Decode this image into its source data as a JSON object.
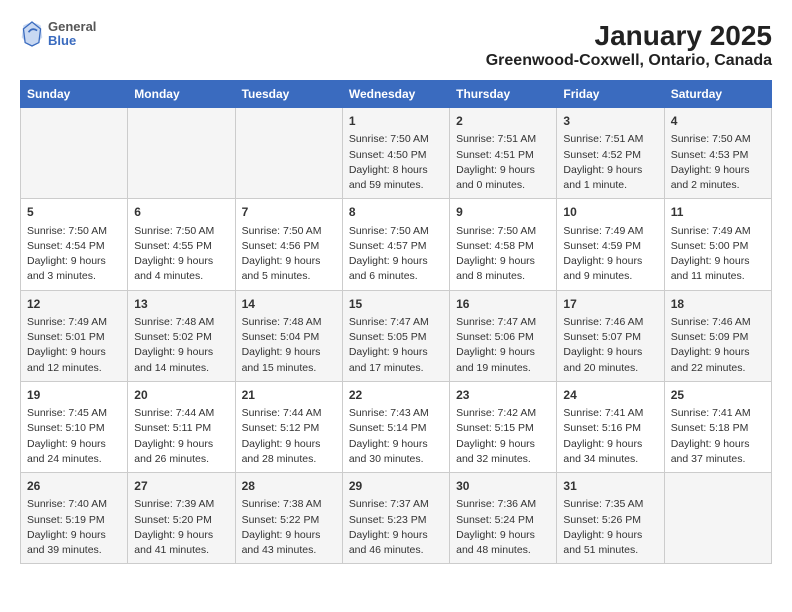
{
  "header": {
    "logo_line1": "General",
    "logo_line2": "Blue",
    "title": "January 2025",
    "subtitle": "Greenwood-Coxwell, Ontario, Canada"
  },
  "days_of_week": [
    "Sunday",
    "Monday",
    "Tuesday",
    "Wednesday",
    "Thursday",
    "Friday",
    "Saturday"
  ],
  "weeks": [
    [
      {
        "day": "",
        "info": ""
      },
      {
        "day": "",
        "info": ""
      },
      {
        "day": "",
        "info": ""
      },
      {
        "day": "1",
        "info": "Sunrise: 7:50 AM\nSunset: 4:50 PM\nDaylight: 8 hours and 59 minutes."
      },
      {
        "day": "2",
        "info": "Sunrise: 7:51 AM\nSunset: 4:51 PM\nDaylight: 9 hours and 0 minutes."
      },
      {
        "day": "3",
        "info": "Sunrise: 7:51 AM\nSunset: 4:52 PM\nDaylight: 9 hours and 1 minute."
      },
      {
        "day": "4",
        "info": "Sunrise: 7:50 AM\nSunset: 4:53 PM\nDaylight: 9 hours and 2 minutes."
      }
    ],
    [
      {
        "day": "5",
        "info": "Sunrise: 7:50 AM\nSunset: 4:54 PM\nDaylight: 9 hours and 3 minutes."
      },
      {
        "day": "6",
        "info": "Sunrise: 7:50 AM\nSunset: 4:55 PM\nDaylight: 9 hours and 4 minutes."
      },
      {
        "day": "7",
        "info": "Sunrise: 7:50 AM\nSunset: 4:56 PM\nDaylight: 9 hours and 5 minutes."
      },
      {
        "day": "8",
        "info": "Sunrise: 7:50 AM\nSunset: 4:57 PM\nDaylight: 9 hours and 6 minutes."
      },
      {
        "day": "9",
        "info": "Sunrise: 7:50 AM\nSunset: 4:58 PM\nDaylight: 9 hours and 8 minutes."
      },
      {
        "day": "10",
        "info": "Sunrise: 7:49 AM\nSunset: 4:59 PM\nDaylight: 9 hours and 9 minutes."
      },
      {
        "day": "11",
        "info": "Sunrise: 7:49 AM\nSunset: 5:00 PM\nDaylight: 9 hours and 11 minutes."
      }
    ],
    [
      {
        "day": "12",
        "info": "Sunrise: 7:49 AM\nSunset: 5:01 PM\nDaylight: 9 hours and 12 minutes."
      },
      {
        "day": "13",
        "info": "Sunrise: 7:48 AM\nSunset: 5:02 PM\nDaylight: 9 hours and 14 minutes."
      },
      {
        "day": "14",
        "info": "Sunrise: 7:48 AM\nSunset: 5:04 PM\nDaylight: 9 hours and 15 minutes."
      },
      {
        "day": "15",
        "info": "Sunrise: 7:47 AM\nSunset: 5:05 PM\nDaylight: 9 hours and 17 minutes."
      },
      {
        "day": "16",
        "info": "Sunrise: 7:47 AM\nSunset: 5:06 PM\nDaylight: 9 hours and 19 minutes."
      },
      {
        "day": "17",
        "info": "Sunrise: 7:46 AM\nSunset: 5:07 PM\nDaylight: 9 hours and 20 minutes."
      },
      {
        "day": "18",
        "info": "Sunrise: 7:46 AM\nSunset: 5:09 PM\nDaylight: 9 hours and 22 minutes."
      }
    ],
    [
      {
        "day": "19",
        "info": "Sunrise: 7:45 AM\nSunset: 5:10 PM\nDaylight: 9 hours and 24 minutes."
      },
      {
        "day": "20",
        "info": "Sunrise: 7:44 AM\nSunset: 5:11 PM\nDaylight: 9 hours and 26 minutes."
      },
      {
        "day": "21",
        "info": "Sunrise: 7:44 AM\nSunset: 5:12 PM\nDaylight: 9 hours and 28 minutes."
      },
      {
        "day": "22",
        "info": "Sunrise: 7:43 AM\nSunset: 5:14 PM\nDaylight: 9 hours and 30 minutes."
      },
      {
        "day": "23",
        "info": "Sunrise: 7:42 AM\nSunset: 5:15 PM\nDaylight: 9 hours and 32 minutes."
      },
      {
        "day": "24",
        "info": "Sunrise: 7:41 AM\nSunset: 5:16 PM\nDaylight: 9 hours and 34 minutes."
      },
      {
        "day": "25",
        "info": "Sunrise: 7:41 AM\nSunset: 5:18 PM\nDaylight: 9 hours and 37 minutes."
      }
    ],
    [
      {
        "day": "26",
        "info": "Sunrise: 7:40 AM\nSunset: 5:19 PM\nDaylight: 9 hours and 39 minutes."
      },
      {
        "day": "27",
        "info": "Sunrise: 7:39 AM\nSunset: 5:20 PM\nDaylight: 9 hours and 41 minutes."
      },
      {
        "day": "28",
        "info": "Sunrise: 7:38 AM\nSunset: 5:22 PM\nDaylight: 9 hours and 43 minutes."
      },
      {
        "day": "29",
        "info": "Sunrise: 7:37 AM\nSunset: 5:23 PM\nDaylight: 9 hours and 46 minutes."
      },
      {
        "day": "30",
        "info": "Sunrise: 7:36 AM\nSunset: 5:24 PM\nDaylight: 9 hours and 48 minutes."
      },
      {
        "day": "31",
        "info": "Sunrise: 7:35 AM\nSunset: 5:26 PM\nDaylight: 9 hours and 51 minutes."
      },
      {
        "day": "",
        "info": ""
      }
    ]
  ]
}
